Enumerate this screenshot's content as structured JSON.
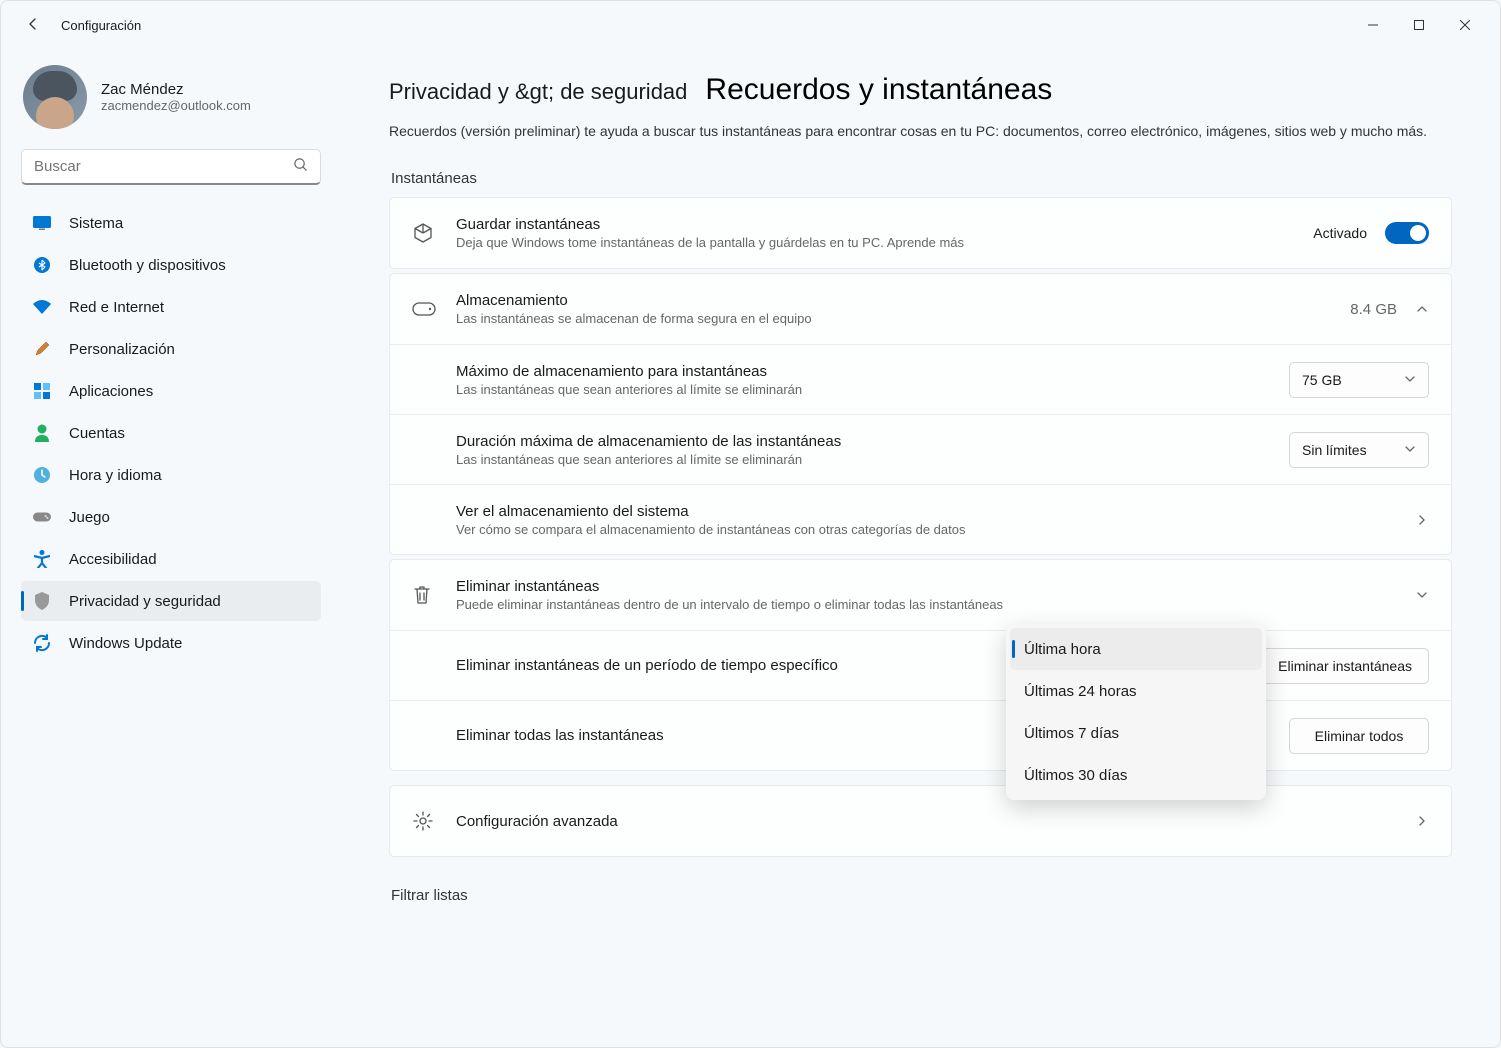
{
  "app_title": "Configuración",
  "profile": {
    "name": "Zac Méndez",
    "email": "zacmendez@outlook.com"
  },
  "search": {
    "placeholder": "Buscar"
  },
  "sidebar": {
    "items": [
      {
        "label": "Sistema",
        "icon": "monitor"
      },
      {
        "label": "Bluetooth y dispositivos",
        "icon": "bluetooth"
      },
      {
        "label": "Red e Internet",
        "icon": "wifi"
      },
      {
        "label": "Personalización",
        "icon": "brush"
      },
      {
        "label": "Aplicaciones",
        "icon": "apps"
      },
      {
        "label": "Cuentas",
        "icon": "person"
      },
      {
        "label": "Hora y idioma",
        "icon": "clock"
      },
      {
        "label": "Juego",
        "icon": "gamepad"
      },
      {
        "label": "Accesibilidad",
        "icon": "accessibility"
      },
      {
        "label": "Privacidad y seguridad",
        "icon": "shield",
        "selected": true
      },
      {
        "label": "Windows Update",
        "icon": "update"
      }
    ]
  },
  "breadcrumb": {
    "level1": "Privacidad y &gt; de seguridad",
    "level2": "Recuerdos y instantáneas"
  },
  "page_description": "Recuerdos (versión preliminar) te ayuda a buscar tus instantáneas para encontrar cosas en tu PC: documentos, correo electrónico, imágenes, sitios web y mucho más.",
  "section_snapshots_title": "Instantáneas",
  "card_save": {
    "title": "Guardar instantáneas",
    "sub": "Deja que Windows tome instantáneas de la pantalla y guárdelas en tu PC. Aprende más",
    "toggle_state_label": "Activado"
  },
  "card_storage": {
    "title": "Almacenamiento",
    "sub": "Las instantáneas se almacenan de forma segura en el equipo",
    "value": "8.4 GB",
    "max_title": "Máximo de almacenamiento para instantáneas",
    "max_sub": "Las instantáneas que sean anteriores al límite se eliminarán",
    "max_value": "75 GB",
    "duration_title": "Duración máxima de almacenamiento de las instantáneas",
    "duration_sub": "Las instantáneas que sean anteriores al límite se eliminarán",
    "duration_value": "Sin límites",
    "system_title": "Ver el almacenamiento del sistema",
    "system_sub": "Ver cómo se compara el almacenamiento de instantáneas con otras categorías de datos"
  },
  "card_delete": {
    "title": "Eliminar instantáneas",
    "sub": "Puede eliminar instantáneas dentro de un intervalo de tiempo o eliminar todas las instantáneas",
    "range_title": "Eliminar instantáneas de un período de tiempo específico",
    "range_button": "Eliminar instantáneas",
    "all_title": "Eliminar todas las instantáneas",
    "all_button": "Eliminar todos"
  },
  "card_advanced": {
    "title": "Configuración avanzada"
  },
  "section_filter_title": "Filtrar listas",
  "popup_options": [
    "Última hora",
    "Últimas 24 horas",
    "Últimos 7 días",
    "Últimos 30 días"
  ]
}
